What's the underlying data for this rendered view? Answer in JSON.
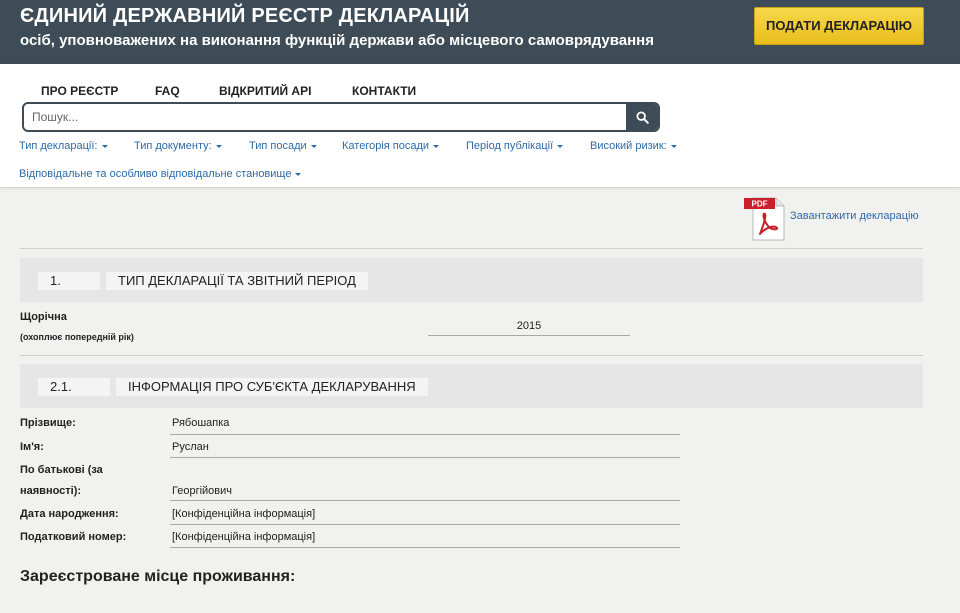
{
  "header": {
    "title": "ЄДИНИЙ ДЕРЖАВНИЙ РЕЄСТР ДЕКЛАРАЦІЙ",
    "subtitle": "осіб, уповноважених на виконання функцій держави або місцевого самоврядування",
    "submit_button": "ПОДАТИ ДЕКЛАРАЦІЮ",
    "accent_color": "#3d4c56",
    "button_color": "#f0c932"
  },
  "nav": {
    "items": [
      "ПРО РЕЄСТР",
      "FAQ",
      "ВІДКРИТИЙ API",
      "КОНТАКТИ"
    ]
  },
  "search": {
    "placeholder": "Пошук...",
    "value": "",
    "icon": "search-icon"
  },
  "filters": [
    "Тип декларації:",
    "Тип документу:",
    "Тип посади",
    "Категорія посади",
    "Період публікації",
    "Високий ризик:",
    "Відповідальне та особливо відповідальне становище"
  ],
  "download": {
    "label": "Завантажити декларацію",
    "icon": "pdf-icon",
    "icon_text": "PDF"
  },
  "section1": {
    "number": "1.",
    "title": "ТИП ДЕКЛАРАЦІЇ ТА ЗВІТНИЙ ПЕРІОД",
    "type_label": "Щорічна",
    "type_note": "(охоплює попередній рік)",
    "year": "2015"
  },
  "section2": {
    "number": "2.1.",
    "title": "ІНФОРМАЦІЯ ПРО СУБ'ЄКТА ДЕКЛАРУВАННЯ",
    "fields": [
      {
        "label": "Прізвище:",
        "value": "Рябошапка"
      },
      {
        "label": "Ім'я:",
        "value": "Руслан"
      },
      {
        "label": "По батькові (за",
        "label2": "наявності):",
        "value": "Георгійович"
      },
      {
        "label": "Дата народження:",
        "value": "[Конфіденційна інформація]"
      },
      {
        "label": "Податковий номер:",
        "value": "[Конфіденційна інформація]"
      }
    ]
  },
  "residence": {
    "heading": "Зареєстроване місце проживання:"
  }
}
